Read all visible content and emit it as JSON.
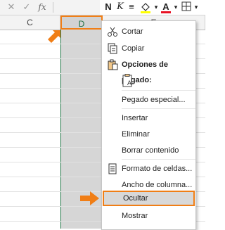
{
  "formula_bar": {
    "cancel_glyph": "✕",
    "enter_glyph": "✓",
    "fx_label": "fx"
  },
  "ribbon": {
    "bold": "N",
    "italic": "K",
    "font_color": "A"
  },
  "columns": [
    "C",
    "D",
    "E"
  ],
  "selected_column": "D",
  "context_menu": {
    "items": [
      {
        "label": "Cortar",
        "icon": "scissors-icon"
      },
      {
        "label": "Copiar",
        "icon": "copy-icon"
      },
      {
        "label": "Opciones de pegado:",
        "icon": "paste-icon"
      },
      {
        "label": "Pegado especial...",
        "icon": ""
      },
      {
        "label": "Insertar",
        "icon": ""
      },
      {
        "label": "Eliminar",
        "icon": ""
      },
      {
        "label": "Borrar contenido",
        "icon": ""
      },
      {
        "label": "Formato de celdas...",
        "icon": "format-cells-icon"
      },
      {
        "label": "Ancho de columna...",
        "icon": ""
      },
      {
        "label": "Ocultar",
        "icon": ""
      },
      {
        "label": "Mostrar",
        "icon": ""
      }
    ],
    "highlighted": "Ocultar"
  },
  "colors": {
    "accent": "#f07e16",
    "excel_green": "#217346",
    "font_red": "#e81123"
  }
}
